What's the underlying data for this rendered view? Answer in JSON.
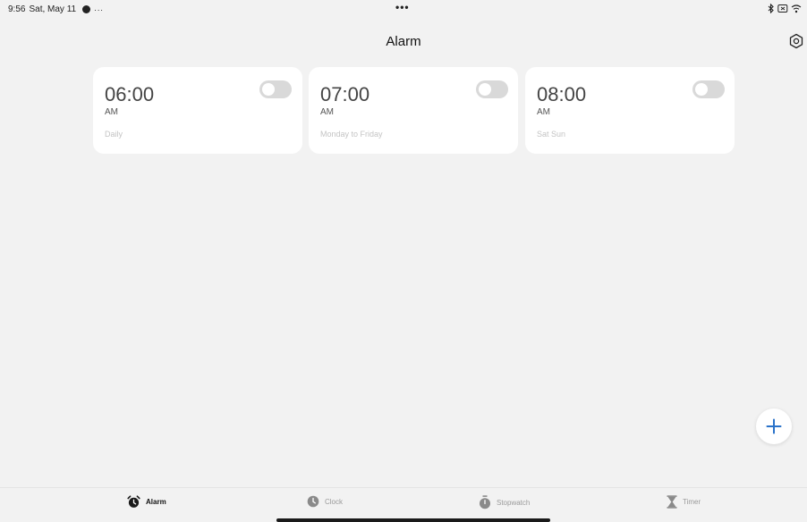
{
  "status_bar": {
    "time": "9:56",
    "date": "Sat, May 11",
    "left_extra": "···",
    "center_dots": "•••"
  },
  "header": {
    "title": "Alarm",
    "settings_icon": "settings-hexagon-icon"
  },
  "alarms": [
    {
      "time": "06:00",
      "period": "AM",
      "repeat": "Daily",
      "enabled": false
    },
    {
      "time": "07:00",
      "period": "AM",
      "repeat": "Monday to Friday",
      "enabled": false
    },
    {
      "time": "08:00",
      "period": "AM",
      "repeat": "Sat Sun",
      "enabled": false
    }
  ],
  "fab": {
    "icon": "plus-icon",
    "color": "#2a72c9"
  },
  "bottom_nav": {
    "items": [
      {
        "label": "Alarm",
        "icon": "alarm-clock-icon",
        "active": true
      },
      {
        "label": "Clock",
        "icon": "clock-icon",
        "active": false
      },
      {
        "label": "Stopwatch",
        "icon": "stopwatch-icon",
        "active": false
      },
      {
        "label": "Timer",
        "icon": "hourglass-icon",
        "active": false
      }
    ]
  },
  "colors": {
    "background": "#f2f2f2",
    "card": "#ffffff",
    "toggle_off": "#d9d9d9",
    "accent": "#2a72c9"
  }
}
